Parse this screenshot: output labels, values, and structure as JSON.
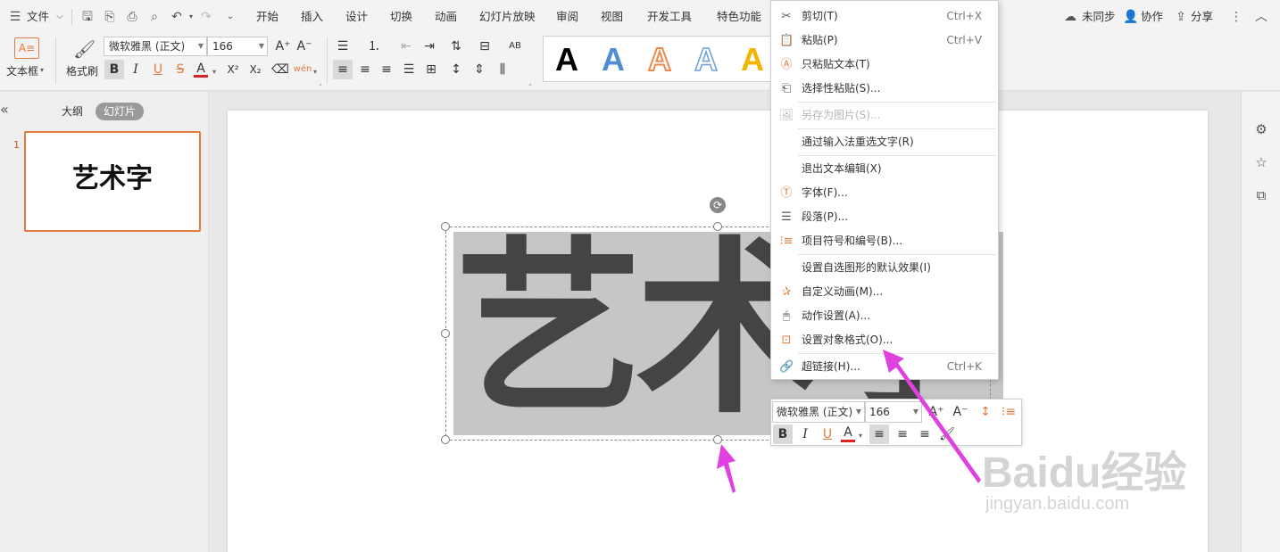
{
  "menubar": {
    "file_label": "文件",
    "tabs": [
      "开始",
      "插入",
      "设计",
      "切换",
      "动画",
      "幻灯片放映",
      "审阅",
      "视图",
      "开发工具",
      "特色功能"
    ],
    "sync_label": "未同步",
    "collab_label": "协作",
    "share_label": "分享"
  },
  "ribbon": {
    "textbox_label": "文本框",
    "format_painter_label": "格式刷",
    "font_name": "微软雅黑 (正文)",
    "font_size": "166",
    "wordart_styles": [
      {
        "letter": "A",
        "color": "#000000"
      },
      {
        "letter": "A",
        "color": "#4f8fd1"
      },
      {
        "letter": "A",
        "color": "#ed8a4b"
      },
      {
        "letter": "A",
        "color": "#6a9fd8"
      },
      {
        "letter": "A",
        "color": "#f4b400"
      }
    ]
  },
  "left_panel": {
    "tab_outline": "大纲",
    "tab_slides": "幻灯片",
    "slide_number": "1",
    "thumb_text": "艺术字"
  },
  "slide": {
    "main_text": "艺术字"
  },
  "context_menu": {
    "items": [
      {
        "label": "剪切(T)",
        "shortcut": "Ctrl+X",
        "icon": "scissors-icon",
        "disabled": false
      },
      {
        "label": "粘贴(P)",
        "shortcut": "Ctrl+V",
        "icon": "paste-icon",
        "disabled": false
      },
      {
        "label": "只粘贴文本(T)",
        "shortcut": "",
        "icon": "paste-text-icon",
        "disabled": false
      },
      {
        "label": "选择性粘贴(S)...",
        "shortcut": "",
        "icon": "paste-special-icon",
        "disabled": false
      },
      {
        "label": "另存为图片(S)...",
        "shortcut": "",
        "icon": "image-icon",
        "disabled": true
      },
      {
        "label": "通过输入法重选文字(R)",
        "shortcut": "",
        "icon": "",
        "disabled": false
      },
      {
        "label": "退出文本编辑(X)",
        "shortcut": "",
        "icon": "",
        "disabled": false
      },
      {
        "label": "字体(F)...",
        "shortcut": "",
        "icon": "font-icon",
        "disabled": false
      },
      {
        "label": "段落(P)...",
        "shortcut": "",
        "icon": "paragraph-icon",
        "disabled": false
      },
      {
        "label": "项目符号和编号(B)...",
        "shortcut": "",
        "icon": "bullets-icon",
        "disabled": false
      },
      {
        "label": "设置自选图形的默认效果(I)",
        "shortcut": "",
        "icon": "",
        "disabled": false
      },
      {
        "label": "自定义动画(M)...",
        "shortcut": "",
        "icon": "animation-icon",
        "disabled": false
      },
      {
        "label": "动作设置(A)...",
        "shortcut": "",
        "icon": "mouse-icon",
        "disabled": false
      },
      {
        "label": "设置对象格式(O)...",
        "shortcut": "",
        "icon": "format-object-icon",
        "disabled": false
      },
      {
        "label": "超链接(H)...",
        "shortcut": "Ctrl+K",
        "icon": "link-icon",
        "disabled": false
      }
    ]
  },
  "mini_toolbar": {
    "font_name": "微软雅黑 (正文)",
    "font_size": "166"
  },
  "watermark": {
    "main": "Baidu经验",
    "sub": "jingyan.baidu.com"
  },
  "colors": {
    "accent_orange": "#e07c3e",
    "arrow_magenta": "#e040e0"
  }
}
